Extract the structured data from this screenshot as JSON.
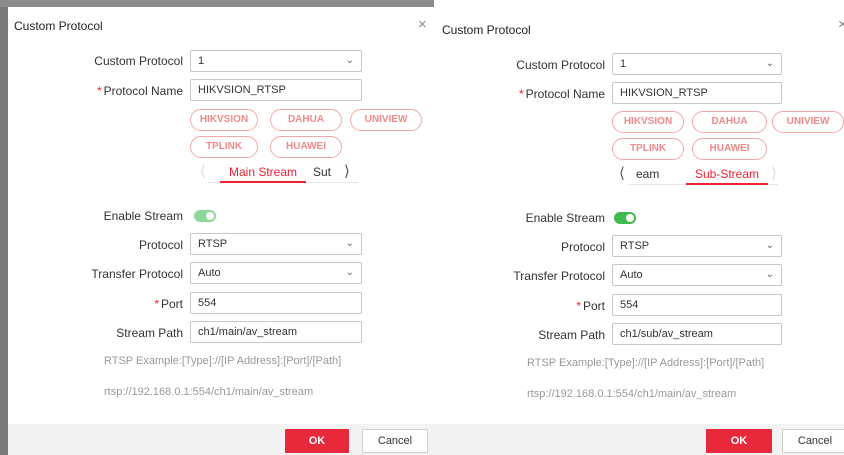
{
  "colors": {
    "accent": "#e8283b",
    "toggle_on": "#3fba4f",
    "chip_text": "#f08a8a"
  },
  "dialog_main": {
    "title": "Custom Protocol",
    "close_glyph": "×",
    "custom_protocol_label": "Custom Protocol",
    "custom_protocol_value": "1",
    "protocol_name_label": "Protocol Name",
    "protocol_name_value": "HIKVSION_RTSP",
    "presets": [
      "HIKVSION",
      "DAHUA",
      "UNIVIEW",
      "TPLINK",
      "HUAWEI"
    ],
    "tab_active": "Main Stream",
    "tab_other": "Sut",
    "enable_stream_label": "Enable Stream",
    "enable_stream_on": true,
    "protocol_label": "Protocol",
    "protocol_value": "RTSP",
    "transfer_label": "Transfer Protocol",
    "transfer_value": "Auto",
    "port_label": "Port",
    "port_value": "554",
    "stream_path_label": "Stream Path",
    "stream_path_value": "ch1/main/av_stream",
    "example_text": "RTSP Example:[Type]://[IP Address]:[Port]/[Path]",
    "example_url": "rtsp://192.168.0.1:554/ch1/main/av_stream",
    "ok_label": "OK",
    "cancel_label": "Cancel"
  },
  "dialog_sub": {
    "title": "Custom Protocol",
    "close_glyph": "×",
    "custom_protocol_label": "Custom Protocol",
    "custom_protocol_value": "1",
    "protocol_name_label": "Protocol Name",
    "protocol_name_value": "HIKVSION_RTSP",
    "presets": [
      "HIKVSION",
      "DAHUA",
      "UNIVIEW",
      "TPLINK",
      "HUAWEI"
    ],
    "tab_other": "eam",
    "tab_active": "Sub-Stream",
    "enable_stream_label": "Enable Stream",
    "enable_stream_on": true,
    "protocol_label": "Protocol",
    "protocol_value": "RTSP",
    "transfer_label": "Transfer Protocol",
    "transfer_value": "Auto",
    "port_label": "Port",
    "port_value": "554",
    "stream_path_label": "Stream Path",
    "stream_path_value": "ch1/sub/av_stream",
    "example_text": "RTSP Example:[Type]://[IP Address]:[Port]/[Path]",
    "example_url": "rtsp://192.168.0.1:554/ch1/main/av_stream",
    "ok_label": "OK",
    "cancel_label": "Cancel"
  }
}
